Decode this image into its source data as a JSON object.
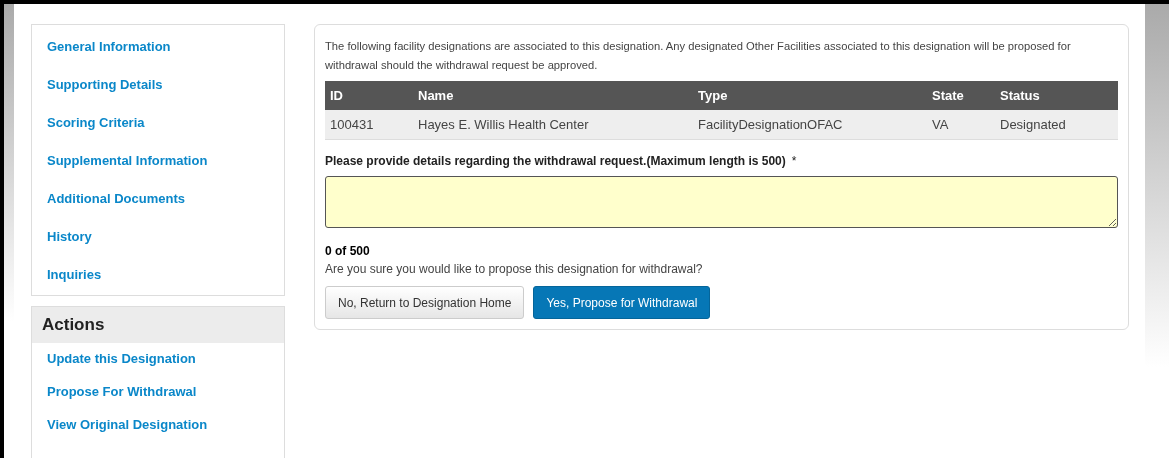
{
  "nav": {
    "items": [
      {
        "label": "General Information"
      },
      {
        "label": "Supporting Details"
      },
      {
        "label": "Scoring Criteria"
      },
      {
        "label": "Supplemental Information"
      },
      {
        "label": "Additional Documents"
      },
      {
        "label": "History"
      },
      {
        "label": "Inquiries"
      }
    ]
  },
  "actions": {
    "title": "Actions",
    "items": [
      {
        "label": "Update this Designation"
      },
      {
        "label": "Propose For Withdrawal"
      },
      {
        "label": "View Original Designation"
      }
    ]
  },
  "main": {
    "intro": "The following facility designations are associated to this designation. Any designated Other Facilities associated to this designation will be proposed for withdrawal should the withdrawal request be approved.",
    "table": {
      "columns": [
        "ID",
        "Name",
        "Type",
        "State",
        "Status"
      ],
      "rows": [
        [
          "100431",
          "Hayes E. Willis Health Center",
          "FacilityDesignationOFAC",
          "VA",
          "Designated"
        ]
      ]
    },
    "details_label": "Please provide details regarding the withdrawal request.(Maximum length is 500)",
    "required_mark": "*",
    "counter": "0 of 500",
    "question": "Are you sure you would like to propose this designation for withdrawal?",
    "buttons": [
      {
        "label": "No, Return to Designation Home",
        "kind": "default"
      },
      {
        "label": "Yes, Propose for Withdrawal",
        "kind": "primary"
      }
    ]
  }
}
